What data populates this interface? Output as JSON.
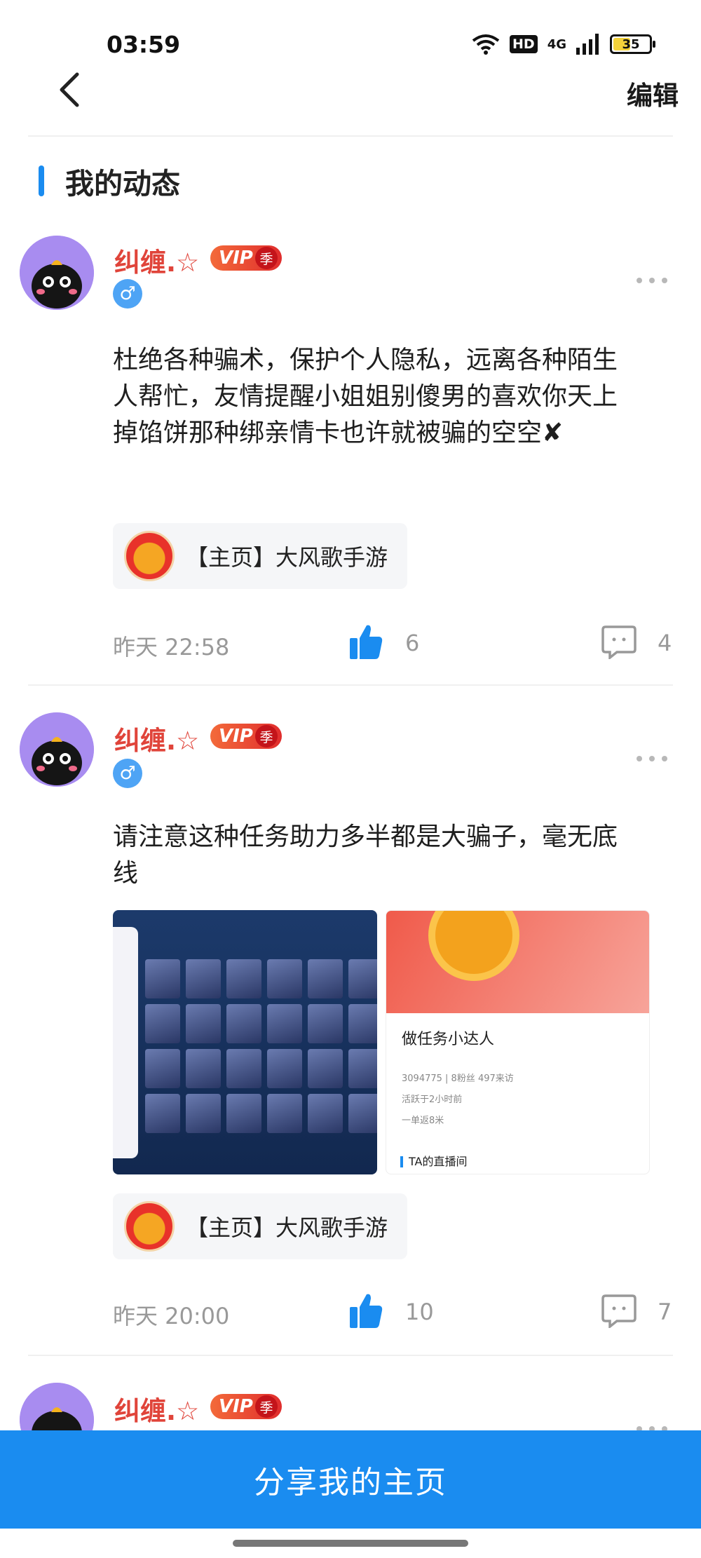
{
  "status_bar": {
    "time": "03:59",
    "hd": "HD",
    "network": "4G",
    "battery": "35",
    "icons": [
      "wifi-icon",
      "signal-icon",
      "battery-icon"
    ]
  },
  "nav": {
    "back_icon": "back-chevron-icon",
    "edit_label": "编辑"
  },
  "section": {
    "title": "我的动态"
  },
  "posts": [
    {
      "username": "纠缠.☆",
      "vip": "VIP",
      "season": "季",
      "gender_symbol": "♂",
      "text": "杜绝各种骗术，保护个人隐私，远离各种陌生人帮忙，友情提醒小姐姐别傻男的喜欢你天上掉馅饼那种绑亲情卡也许就被骗的空空✘",
      "game_tag": "【主页】大风歌手游",
      "time": "昨天 22:58",
      "likes": "6",
      "comments": "4"
    },
    {
      "username": "纠缠.☆",
      "vip": "VIP",
      "season": "季",
      "gender_symbol": "♂",
      "text": "请注意这种任务助力多半都是大骗子，毫无底线",
      "images": {
        "profile_name": "做任务小达人",
        "profile_stats": "3094775 | 8粉丝 497来访",
        "profile_active": "活跃于2小时前",
        "profile_distance": "一单返8米",
        "profile_section": "TA的直播间"
      },
      "game_tag": "【主页】大风歌手游",
      "time": "昨天 20:00",
      "likes": "10",
      "comments": "7"
    },
    {
      "username": "纠缠.☆",
      "vip": "VIP",
      "season": "季"
    }
  ],
  "share_button": "分享我的主页"
}
